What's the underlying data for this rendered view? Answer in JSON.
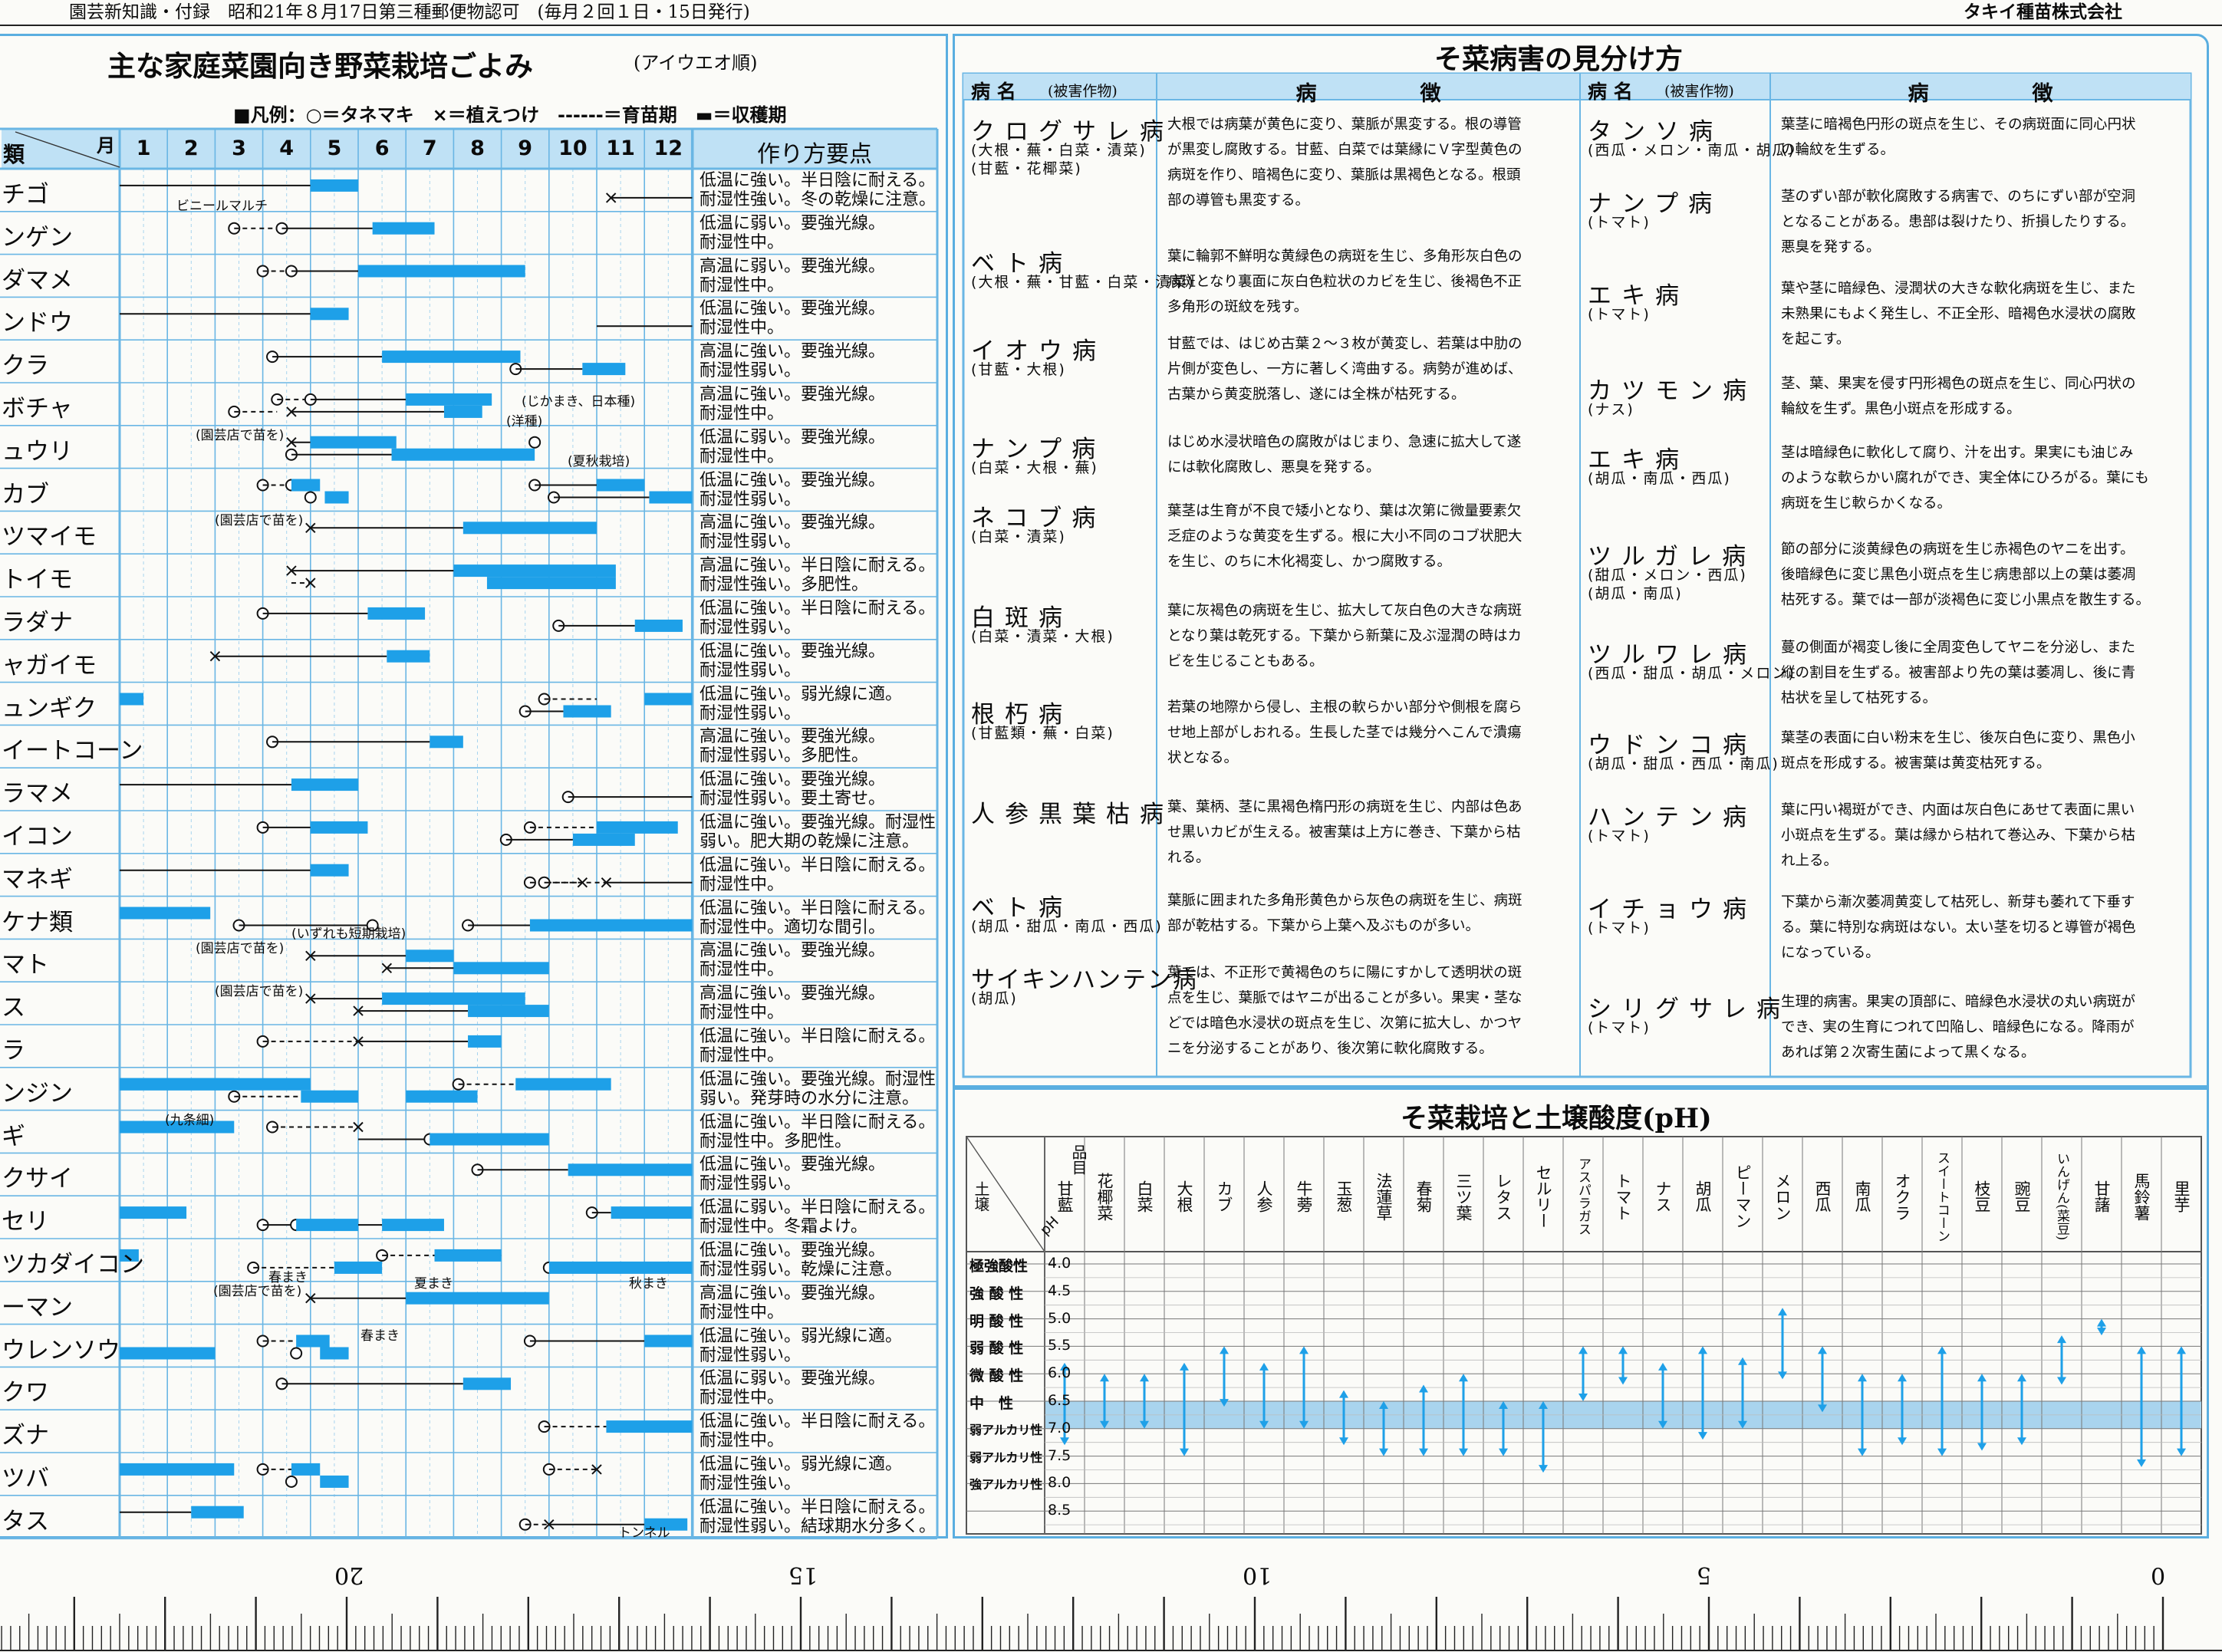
{
  "header": {
    "left": "園芸新知識・付録　昭和21年８月17日第三種郵便物認可　(毎月２回１日・15日発行)",
    "right": "タキイ種苗株式会社"
  },
  "calendar": {
    "title": "主な家庭菜園向き野菜栽培ごよみ",
    "subtitle": "(アイウエオ順)",
    "legend": "■凡例：○＝タネマキ　×＝植えつけ　------＝育苗期　▬＝収穫期",
    "head_kind": "類",
    "head_month": "月",
    "head_notes": "作り方要点",
    "months": [
      "1",
      "2",
      "3",
      "4",
      "5",
      "6",
      "7",
      "8",
      "9",
      "10",
      "11",
      "12"
    ],
    "rows": [
      {
        "name": "チゴ",
        "note1": "低温に強い。半日陰に耐える。",
        "note2": "耐湿性強い。冬の乾燥に注意。",
        "ann": "ビニールマルチ"
      },
      {
        "name": "ンゲン",
        "note1": "低温に弱い。要強光線。",
        "note2": "耐湿性中。"
      },
      {
        "name": "ダマメ",
        "note1": "高温に弱い。要強光線。",
        "note2": "耐湿性中。"
      },
      {
        "name": "ンドウ",
        "note1": "低温に強い。要強光線。",
        "note2": "耐湿性中。"
      },
      {
        "name": "クラ",
        "note1": "高温に強い。要強光線。",
        "note2": "耐湿性弱い。"
      },
      {
        "name": "ボチャ",
        "note1": "高温に強い。要強光線。",
        "note2": "耐湿性中。",
        "ann": "(じかまき、日本種)",
        "ann2": "(洋種)"
      },
      {
        "name": "ュウリ",
        "note1": "低温に弱い。要強光線。",
        "note2": "耐湿性中。",
        "ann": "(園芸店で苗を)",
        "ann2": "(夏秋栽培)"
      },
      {
        "name": "カブ",
        "note1": "低温に強い。要強光線。",
        "note2": "耐湿性弱い。"
      },
      {
        "name": "ツマイモ",
        "note1": "高温に強い。要強光線。",
        "note2": "耐湿性弱い。",
        "ann": "(園芸店で苗を)"
      },
      {
        "name": "トイモ",
        "note1": "高温に強い。半日陰に耐える。",
        "note2": "耐湿性強い。多肥性。"
      },
      {
        "name": "ラダナ",
        "note1": "低温に強い。半日陰に耐える。",
        "note2": "耐湿性弱い。"
      },
      {
        "name": "ャガイモ",
        "note1": "低温に強い。要強光線。",
        "note2": "耐湿性弱い。"
      },
      {
        "name": "ュンギク",
        "note1": "低温に強い。弱光線に適。",
        "note2": "耐湿性弱い。"
      },
      {
        "name": "イートコーン",
        "note1": "高温に強い。要強光線。",
        "note2": "耐湿性弱い。多肥性。"
      },
      {
        "name": "ラマメ",
        "note1": "低温に強い。要強光線。",
        "note2": "耐湿性弱い。要土寄せ。"
      },
      {
        "name": "イコン",
        "note1": "低温に強い。要強光線。耐湿性",
        "note2": "弱い。肥大期の乾燥に注意。"
      },
      {
        "name": "マネギ",
        "note1": "低温に強い。半日陰に耐える。",
        "note2": "耐湿性中。"
      },
      {
        "name": "ケナ類",
        "note1": "低温に強い。半日陰に耐える。",
        "note2": "耐湿性中。適切な間引。",
        "ann": "(いずれも短期栽培)"
      },
      {
        "name": "マト",
        "note1": "高温に強い。要強光線。",
        "note2": "耐湿性中。",
        "ann": "(園芸店で苗を)"
      },
      {
        "name": "ス",
        "note1": "高温に強い。要強光線。",
        "note2": "耐湿性中。",
        "ann": "(園芸店で苗を)"
      },
      {
        "name": "ラ",
        "note1": "低温に強い。半日陰に耐える。",
        "note2": "耐湿性中。"
      },
      {
        "name": "ンジン",
        "note1": "低温に強い。要強光線。耐湿性",
        "note2": "弱い。発芽時の水分に注意。"
      },
      {
        "name": "ギ",
        "note1": "低温に強い。半日陰に耐える。",
        "note2": "耐湿性中。多肥性。",
        "ann": "(九条細)"
      },
      {
        "name": "クサイ",
        "note1": "低温に強い。要強光線。",
        "note2": "耐湿性弱い。"
      },
      {
        "name": "セリ",
        "note1": "低温に弱い。半日陰に耐える。",
        "note2": "耐湿性中。冬霜よけ。"
      },
      {
        "name": "ツカダイコン",
        "note1": "低温に強い。要強光線。",
        "note2": "耐湿性弱い。乾燥に注意。",
        "ann": "春まき",
        "ann2": "夏まき",
        "ann3": "秋まき"
      },
      {
        "name": "ーマン",
        "note1": "高温に強い。要強光線。",
        "note2": "耐湿性中。",
        "ann": "(園芸店で苗を)"
      },
      {
        "name": "ウレンソウ",
        "note1": "低温に強い。弱光線に適。",
        "note2": "耐湿性弱い。",
        "ann": "春まき"
      },
      {
        "name": "クワ",
        "note1": "低温に弱い。要強光線。",
        "note2": "耐湿性中。"
      },
      {
        "name": "ズナ",
        "note1": "低温に強い。半日陰に耐える。",
        "note2": "耐湿性中。"
      },
      {
        "name": "ツバ",
        "note1": "低温に強い。弱光線に適。",
        "note2": "耐湿性強い。"
      },
      {
        "name": "タス",
        "note1": "低温に強い。半日陰に耐える。",
        "note2": "耐湿性弱い。結球期水分多く。",
        "ann": "トンネル"
      }
    ]
  },
  "disease": {
    "title": "そ菜病害の見分け方",
    "head_name": "病 名",
    "head_host": "(被害作物)",
    "head_sym": "病　　　　　徴",
    "left": [
      {
        "name": "クログサレ病",
        "host": "(大根・蕪・白菜・漬菜)",
        "host2": "(甘藍・花椰菜)",
        "s": [
          "大根では病葉が黄色に変り、葉脈が黒変する。根の導管",
          "が黒変し腐敗する。甘藍、白菜では葉縁にＶ字型黄色の",
          "病斑を作り、暗褐色に変り、葉脈は黒褐色となる。根頭",
          "部の導管も黒変する。"
        ]
      },
      {
        "name": "ベト病",
        "host": "(大根・蕪・甘藍・白菜・漬菜)",
        "s": [
          "葉に輪郭不鮮明な黄緑色の病斑を生じ、多角形灰白色の",
          "病斑となり裏面に灰白色粒状のカビを生じ、後褐色不正",
          "多角形の斑紋を残す。"
        ]
      },
      {
        "name": "イオウ病",
        "host": "(甘藍・大根)",
        "s": [
          "甘藍では、はじめ古葉２～３枚が黄変し、若葉は中肋の",
          "片側が変色し、一方に著しく湾曲する。病勢が進めば、",
          "古葉から黄変脱落し、遂には全株が枯死する。"
        ]
      },
      {
        "name": "ナンプ病",
        "host": "(白菜・大根・蕪)",
        "s": [
          "はじめ水浸状暗色の腐敗がはじまり、急速に拡大して遂",
          "には軟化腐敗し、悪臭を発する。"
        ]
      },
      {
        "name": "ネコブ病",
        "host": "(白菜・漬菜)",
        "s": [
          "葉茎は生育が不良で矮小となり、葉は次第に微量要素欠",
          "乏症のような黄変を生ずる。根に大小不同のコブ状肥大",
          "を生じ、のちに木化褐変し、かつ腐敗する。"
        ]
      },
      {
        "name": "白斑病",
        "host": "(白菜・漬菜・大根)",
        "s": [
          "葉に灰褐色の病斑を生じ、拡大して灰白色の大きな病斑",
          "となり葉は乾死する。下葉から新葉に及ぶ湿潤の時はカ",
          "ビを生じることもある。"
        ]
      },
      {
        "name": "根朽病",
        "host": "(甘藍類・蕪・白菜)",
        "s": [
          "若葉の地際から侵し、主根の軟らかい部分や側根を腐ら",
          "せ地上部がしおれる。生長した茎では幾分へこんで潰瘍",
          "状となる。"
        ]
      },
      {
        "name": "人参黒葉枯病",
        "host": "",
        "s": [
          "葉、葉柄、茎に黒褐色楕円形の病斑を生じ、内部は色あ",
          "せ黒いカビが生える。被害葉は上方に巻き、下葉から枯",
          "れる。"
        ]
      },
      {
        "name": "ベト病",
        "host": "(胡瓜・甜瓜・南瓜・西瓜)",
        "s": [
          "葉脈に囲まれた多角形黄色から灰色の病斑を生じ、病斑",
          "部が乾枯する。下葉から上葉へ及ぶものが多い。"
        ]
      },
      {
        "name": "サイキンハンテン病",
        "host": "(胡瓜)",
        "s": [
          "葉では、不正形で黄褐色のちに陽にすかして透明状の斑",
          "点を生じ、葉脈ではヤニが出ることが多い。果実・茎な",
          "どでは暗色水浸状の斑点を生じ、次第に拡大し、かつヤ",
          "ニを分泌することがあり、後次第に軟化腐敗する。"
        ]
      }
    ],
    "right": [
      {
        "name": "タンソ病",
        "host": "(西瓜・メロン・南瓜・胡瓜)",
        "s": [
          "葉茎に暗褐色円形の斑点を生じ、その病斑面に同心円状",
          "の輪紋を生ずる。"
        ]
      },
      {
        "name": "ナンプ病",
        "host": "(トマト)",
        "s": [
          "茎のずい部が軟化腐敗する病害で、のちにずい部が空洞",
          "となることがある。患部は裂けたり、折損したりする。",
          "悪臭を発する。"
        ]
      },
      {
        "name": "エキ病",
        "host": "(トマト)",
        "s": [
          "葉や茎に暗緑色、浸潤状の大きな軟化病斑を生じ、また",
          "未熟果にもよく発生し、不正全形、暗褐色水浸状の腐敗",
          "を起こす。"
        ]
      },
      {
        "name": "カツモン病",
        "host": "(ナス)",
        "s": [
          "茎、葉、果実を侵す円形褐色の斑点を生じ、同心円状の",
          "輪紋を生ず。黒色小斑点を形成する。"
        ]
      },
      {
        "name": "エキ病",
        "host": "(胡瓜・南瓜・西瓜)",
        "s": [
          "茎は暗緑色に軟化して腐り、汁を出す。果実にも油じみ",
          "のような軟らかい腐れができ、実全体にひろがる。葉にも",
          "病斑を生じ軟らかくなる。"
        ]
      },
      {
        "name": "ツルガレ病",
        "host": "(甜瓜・メロン・西瓜)",
        "host2": "(胡瓜・南瓜)",
        "s": [
          "節の部分に淡黄緑色の病斑を生じ赤褐色のヤニを出す。",
          "後暗緑色に変じ黒色小斑点を生じ病患部以上の葉は萎凋",
          "枯死する。葉では一部が淡褐色に変じ小黒点を散生する。"
        ]
      },
      {
        "name": "ツルワレ病",
        "host": "(西瓜・甜瓜・胡瓜・メロン)",
        "s": [
          "蔓の側面が褐変し後に全周変色してヤニを分泌し、また",
          "縦の割目を生ずる。被害部より先の葉は萎凋し、後に青",
          "枯状を呈して枯死する。"
        ]
      },
      {
        "name": "ウドンコ病",
        "host": "(胡瓜・甜瓜・西瓜・南瓜)",
        "s": [
          "葉茎の表面に白い粉末を生じ、後灰白色に変り、黒色小",
          "斑点を形成する。被害葉は黄変枯死する。"
        ]
      },
      {
        "name": "ハンテン病",
        "host": "(トマト)",
        "s": [
          "葉に円い褐斑ができ、内面は灰白色にあせて表面に黒い",
          "小斑点を生ずる。葉は縁から枯れて巻込み、下葉から枯",
          "れ上る。"
        ]
      },
      {
        "name": "イチョウ病",
        "host": "(トマト)",
        "s": [
          "下葉から漸次萎凋黄変して枯死し、新芽も萎れて下垂す",
          "る。葉に特別な病斑はない。太い茎を切ると導管が褐色",
          "になっている。"
        ]
      },
      {
        "name": "シリグサレ病",
        "host": "(トマト)",
        "s": [
          "生理的病害。果実の頂部に、暗緑色水浸状の丸い病斑が",
          "でき、実の生育につれて凹陥し、暗緑色になる。降雨が",
          "あれば第２次寄生菌によって黒くなる。"
        ]
      }
    ]
  },
  "ph": {
    "title": "そ菜栽培と土壌酸度(pH)",
    "corner_top": "品目",
    "corner_left": "土壌",
    "corner_ph": "pH",
    "levels": [
      "極強酸性",
      "強 酸 性",
      "明 酸 性",
      "弱 酸 性",
      "微 酸 性",
      "中　性",
      "弱アルカリ性",
      "弱アルカリ性",
      "強アルカリ性"
    ],
    "values": [
      "4.0",
      "4.5",
      "5.0",
      "5.5",
      "6.0",
      "6.5",
      "7.0",
      "7.5",
      "8.0",
      "8.5"
    ],
    "crops": [
      {
        "name": "甘藍",
        "lo": 5.8,
        "hi": 7.3
      },
      {
        "name": "花椰菜",
        "lo": 6.0,
        "hi": 7.0
      },
      {
        "name": "白菜",
        "lo": 6.0,
        "hi": 7.0
      },
      {
        "name": "大根",
        "lo": 5.8,
        "hi": 7.5
      },
      {
        "name": "カブ",
        "lo": 5.5,
        "hi": 6.6
      },
      {
        "name": "人参",
        "lo": 5.8,
        "hi": 7.0
      },
      {
        "name": "牛蒡",
        "lo": 5.5,
        "hi": 7.0
      },
      {
        "name": "玉葱",
        "lo": 6.3,
        "hi": 7.3
      },
      {
        "name": "法蓮草",
        "lo": 6.5,
        "hi": 7.5
      },
      {
        "name": "春菊",
        "lo": 6.2,
        "hi": 7.5
      },
      {
        "name": "三ツ葉",
        "lo": 6.0,
        "hi": 7.5
      },
      {
        "name": "レタス",
        "lo": 6.5,
        "hi": 7.5
      },
      {
        "name": "セルリー",
        "lo": 6.5,
        "hi": 7.8
      },
      {
        "name": "アスパラガス",
        "lo": 5.5,
        "hi": 6.5
      },
      {
        "name": "トマト",
        "lo": 5.5,
        "hi": 6.2
      },
      {
        "name": "ナス",
        "lo": 5.8,
        "hi": 7.0
      },
      {
        "name": "胡瓜",
        "lo": 5.5,
        "hi": 7.2
      },
      {
        "name": "ピーマン",
        "lo": 5.7,
        "hi": 7.0
      },
      {
        "name": "メロン",
        "lo": 4.8,
        "hi": 6.1
      },
      {
        "name": "西瓜",
        "lo": 5.5,
        "hi": 6.7
      },
      {
        "name": "南瓜",
        "lo": 6.0,
        "hi": 7.5
      },
      {
        "name": "オクラ",
        "lo": 6.0,
        "hi": 7.3
      },
      {
        "name": "スイートコーン",
        "lo": 5.5,
        "hi": 7.5
      },
      {
        "name": "枝豆",
        "lo": 6.0,
        "hi": 7.4
      },
      {
        "name": "豌豆",
        "lo": 6.0,
        "hi": 7.3
      },
      {
        "name": "いんげん(菜豆)",
        "lo": 5.3,
        "hi": 6.2
      },
      {
        "name": "甘藷",
        "lo": 5.0,
        "hi": 5.3
      },
      {
        "name": "馬鈴薯",
        "lo": 5.5,
        "hi": 7.7
      },
      {
        "name": "里芋",
        "lo": 5.5,
        "hi": 7.5
      }
    ]
  },
  "ruler": {
    "labels": [
      "20",
      "15",
      "10",
      "5",
      "0"
    ]
  },
  "colors": {
    "blue": "#1ea0e8",
    "frame": "#5aaee0",
    "phband": "#a9d4ee"
  }
}
